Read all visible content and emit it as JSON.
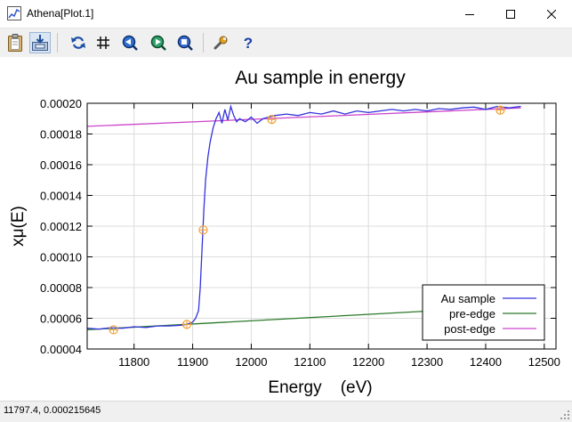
{
  "window": {
    "title": "Athena[Plot.1]",
    "controls": [
      "minimize",
      "maximize",
      "close"
    ]
  },
  "toolbar": {
    "buttons": [
      {
        "icon": "clipboard-icon",
        "pressed": false
      },
      {
        "icon": "save-image-icon",
        "pressed": true
      },
      {
        "icon": "refresh-icon",
        "pressed": false
      },
      {
        "icon": "grid-icon",
        "pressed": false
      },
      {
        "icon": "zoom-back-icon",
        "pressed": false
      },
      {
        "icon": "zoom-forward-icon",
        "pressed": false
      },
      {
        "icon": "zoom-reset-icon",
        "pressed": false
      },
      {
        "icon": "wrench-icon",
        "pressed": false
      },
      {
        "icon": "help-icon",
        "pressed": false
      }
    ]
  },
  "chart_data": {
    "type": "line",
    "title": "Au sample in energy",
    "xlabel": "Energy    (eV)",
    "ylabel": "xμ(E)",
    "xlim": [
      11720,
      12520
    ],
    "ylim": [
      4e-05,
      0.0002
    ],
    "xticks": [
      11800,
      11900,
      12000,
      12100,
      12200,
      12300,
      12400,
      12500
    ],
    "yticks": [
      "0.00004",
      "0.00006",
      "0.00008",
      "0.00010",
      "0.00012",
      "0.00014",
      "0.00016",
      "0.00018",
      "0.00020"
    ],
    "grid": true,
    "legend_position": "bottom-right",
    "series": [
      {
        "name": "Au sample",
        "color": "#3333dd",
        "x": [
          11720,
          11740,
          11760,
          11780,
          11800,
          11820,
          11840,
          11860,
          11880,
          11890,
          11900,
          11905,
          11910,
          11913,
          11916,
          11919,
          11922,
          11926,
          11930,
          11935,
          11940,
          11945,
          11950,
          11955,
          11960,
          11965,
          11970,
          11975,
          11980,
          11990,
          12000,
          12010,
          12020,
          12030,
          12040,
          12060,
          12080,
          12100,
          12120,
          12140,
          12160,
          12180,
          12200,
          12220,
          12240,
          12260,
          12280,
          12300,
          12320,
          12340,
          12360,
          12380,
          12400,
          12420,
          12440,
          12460
        ],
        "y": [
          5.35e-05,
          5.3e-05,
          5.38e-05,
          5.35e-05,
          5.45e-05,
          5.4e-05,
          5.5e-05,
          5.5e-05,
          5.55e-05,
          5.6e-05,
          5.75e-05,
          6e-05,
          6.5e-05,
          8e-05,
          0.000105,
          0.00013,
          0.00015,
          0.000165,
          0.000175,
          0.000184,
          0.00019,
          0.000194,
          0.000187,
          0.000196,
          0.000189,
          0.000198,
          0.000192,
          0.000188,
          0.00019,
          0.000188,
          0.000191,
          0.000187,
          0.00019,
          0.000191,
          0.000192,
          0.000193,
          0.000192,
          0.000194,
          0.000193,
          0.000195,
          0.000193,
          0.000195,
          0.000194,
          0.000195,
          0.000196,
          0.000195,
          0.000196,
          0.000195,
          0.0001965,
          0.000196,
          0.000197,
          0.0001975,
          0.000196,
          0.000198,
          0.000197,
          0.000198
        ]
      },
      {
        "name": "pre-edge",
        "color": "#2a7a2a",
        "x": [
          11720,
          12460
        ],
        "y": [
          5.25e-05,
          6.8e-05
        ]
      },
      {
        "name": "post-edge",
        "color": "#cc44cc",
        "x": [
          11720,
          12460
        ],
        "y": [
          0.000185,
          0.000197
        ]
      }
    ],
    "markers": {
      "color": "#f0a030",
      "points": [
        [
          11765,
          5.25e-05
        ],
        [
          11890,
          5.6e-05
        ],
        [
          11918,
          0.0001175
        ],
        [
          12035,
          0.0001895
        ],
        [
          12425,
          0.0001955
        ]
      ]
    }
  },
  "status": {
    "text": "11797.4,  0.000215645"
  }
}
